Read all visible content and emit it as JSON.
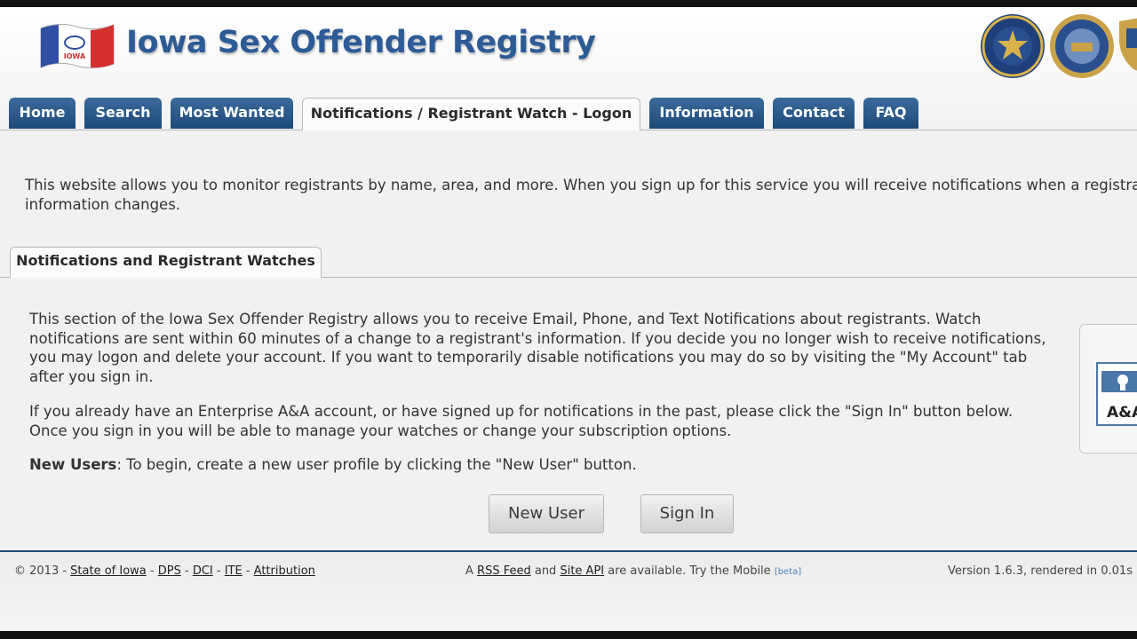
{
  "site": {
    "title": "Iowa Sex Offender Registry"
  },
  "nav": {
    "tabs": [
      {
        "label": "Home"
      },
      {
        "label": "Search"
      },
      {
        "label": "Most Wanted"
      },
      {
        "label": "Notifications / Registrant Watch - Logon",
        "active": true
      },
      {
        "label": "Information"
      },
      {
        "label": "Contact"
      },
      {
        "label": "FAQ"
      }
    ]
  },
  "intro": {
    "text": "This website allows you to monitor registrants by name, area, and more. When you sign up for this service you will receive notifications when a registrant's information changes."
  },
  "section": {
    "tab_label": "Notifications and Registrant Watches",
    "para1": "This section of the Iowa Sex Offender Registry allows you to receive Email, Phone, and Text Notifications about registrants. Watch notifications are sent within 60 minutes of a change to a registrant's information. If you decide you no longer wish to receive notifications, you may logon and delete your account. If you want to temporarily disable notifications you may do so by visiting the \"My Account\" tab after you sign in.",
    "para2": "If you already have an Enterprise A&A account, or have signed up for notifications in the past, please click the \"Sign In\" button below. Once you sign in you will be able to manage your watches or change your subscription options.",
    "new_users_label": "New Users",
    "new_users_text": ": To begin, create a new user profile by clicking the \"New User\" button.",
    "new_user_button": "New User",
    "sign_in_button": "Sign In",
    "side_label": "A&A"
  },
  "footer": {
    "copyright": "© 2013 - ",
    "sep": " - ",
    "links": [
      "State of Iowa",
      "DPS",
      "DCI",
      "ITE",
      "Attribution"
    ],
    "mid_prefix": "A ",
    "rss": "RSS Feed",
    "mid_and": " and ",
    "api": "Site API",
    "mid_suffix": " are available. Try the Mobile ",
    "beta": "[beta]",
    "version": "Version 1.6.3, rendered in 0.01s"
  },
  "colors": {
    "brand_blue": "#2c5b96",
    "tab_blue": "#1e4a78",
    "flag_red": "#d32f2f"
  },
  "icons": [
    "iowa-flag-icon",
    "dps-seal-icon",
    "state-seal-icon",
    "lock-icon"
  ]
}
